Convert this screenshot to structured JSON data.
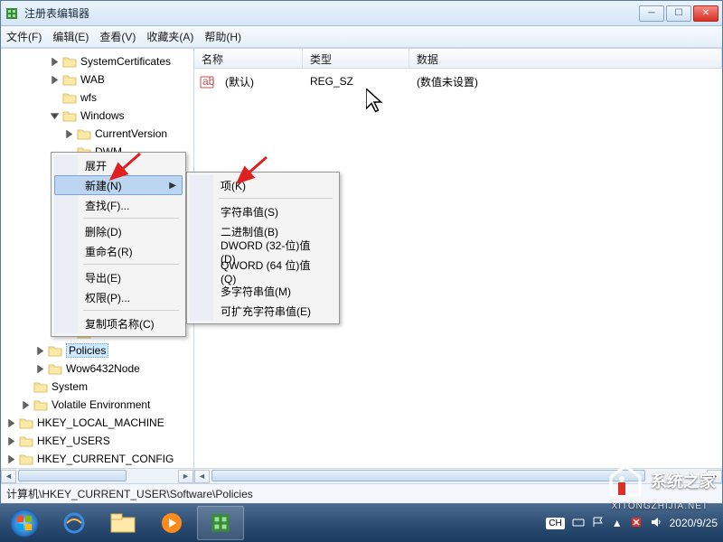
{
  "window": {
    "title": "注册表编辑器"
  },
  "menubar": {
    "file": "文件(F)",
    "edit": "编辑(E)",
    "view": "查看(V)",
    "favorites": "收藏夹(A)",
    "help": "帮助(H)"
  },
  "tree": {
    "items": [
      {
        "label": "SystemCertificates",
        "indent": 3,
        "exp": "closed"
      },
      {
        "label": "WAB",
        "indent": 3,
        "exp": "closed"
      },
      {
        "label": "wfs",
        "indent": 3,
        "exp": "none"
      },
      {
        "label": "Windows",
        "indent": 3,
        "exp": "open"
      },
      {
        "label": "CurrentVersion",
        "indent": 4,
        "exp": "closed"
      },
      {
        "label": "DWM",
        "indent": 4,
        "exp": "none"
      },
      {
        "label": "",
        "indent": 4,
        "exp": "open",
        "blank": true
      },
      {
        "label": "",
        "indent": 4,
        "exp": "none",
        "blank": true
      },
      {
        "label": "",
        "indent": 4,
        "exp": "none",
        "blank": true
      },
      {
        "label": "",
        "indent": 4,
        "exp": "none",
        "blank": true
      },
      {
        "label": "",
        "indent": 4,
        "exp": "none",
        "blank": true
      },
      {
        "label": "",
        "indent": 4,
        "exp": "none",
        "blank": true
      },
      {
        "label": "",
        "indent": 4,
        "exp": "none",
        "blank": true
      },
      {
        "label": "",
        "indent": 4,
        "exp": "none",
        "blank": true
      },
      {
        "label": "",
        "indent": 4,
        "exp": "none",
        "blank": true
      },
      {
        "label": "",
        "indent": 4,
        "exp": "none",
        "blank": true
      },
      {
        "label": "Policies",
        "indent": 2,
        "exp": "closed",
        "selected": true
      },
      {
        "label": "Wow6432Node",
        "indent": 2,
        "exp": "closed"
      },
      {
        "label": "System",
        "indent": 1,
        "exp": "none"
      },
      {
        "label": "Volatile Environment",
        "indent": 1,
        "exp": "closed"
      },
      {
        "label": "HKEY_LOCAL_MACHINE",
        "indent": 0,
        "exp": "closed"
      },
      {
        "label": "HKEY_USERS",
        "indent": 0,
        "exp": "closed"
      },
      {
        "label": "HKEY_CURRENT_CONFIG",
        "indent": 0,
        "exp": "closed"
      }
    ]
  },
  "list": {
    "header": {
      "name": "名称",
      "type": "类型",
      "data": "数据"
    },
    "row": {
      "name": "(默认)",
      "type": "REG_SZ",
      "data": "(数值未设置)"
    }
  },
  "context_menu": {
    "expand": "展开",
    "new": "新建(N)",
    "find": "查找(F)...",
    "delete": "删除(D)",
    "rename": "重命名(R)",
    "export": "导出(E)",
    "permissions": "权限(P)...",
    "copy_key_name": "复制项名称(C)"
  },
  "submenu": {
    "key": "项(K)",
    "string": "字符串值(S)",
    "binary": "二进制值(B)",
    "dword": "DWORD (32-位)值(D)",
    "qword": "QWORD (64 位)值(Q)",
    "multi": "多字符串值(M)",
    "expand": "可扩充字符串值(E)"
  },
  "statusbar": {
    "path": "计算机\\HKEY_CURRENT_USER\\Software\\Policies"
  },
  "taskbar": {
    "ime": "CH",
    "date": "2020/9/25"
  },
  "watermark": {
    "text": "系统之家",
    "sub": "XITONGZHIJIA.NET"
  }
}
